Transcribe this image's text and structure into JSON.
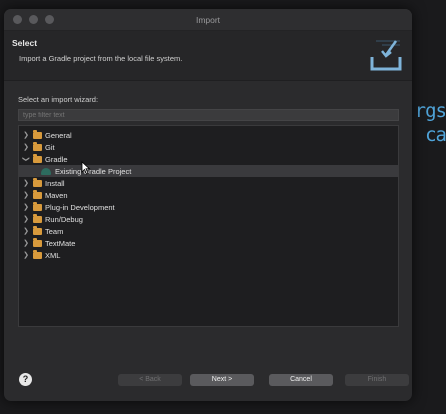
{
  "background": {
    "line1": "rgs",
    "line2": "ca"
  },
  "window": {
    "title": "Import"
  },
  "header": {
    "title": "Select",
    "description": "Import a Gradle project from the local file system."
  },
  "wizard": {
    "prompt": "Select an import wizard:",
    "filter_placeholder": "type filter text"
  },
  "tree": {
    "general": "General",
    "git": "Git",
    "gradle": "Gradle",
    "gradle_child": "Existing Gradle Project",
    "install": "Install",
    "maven": "Maven",
    "plugin": "Plug-in Development",
    "rundebug": "Run/Debug",
    "team": "Team",
    "textmate": "TextMate",
    "xml": "XML"
  },
  "footer": {
    "help": "?",
    "back": "< Back",
    "next": "Next >",
    "cancel": "Cancel",
    "finish": "Finish"
  },
  "colors": {
    "folder": "#d89a3c",
    "accent_blue": "#4fa3d8"
  }
}
